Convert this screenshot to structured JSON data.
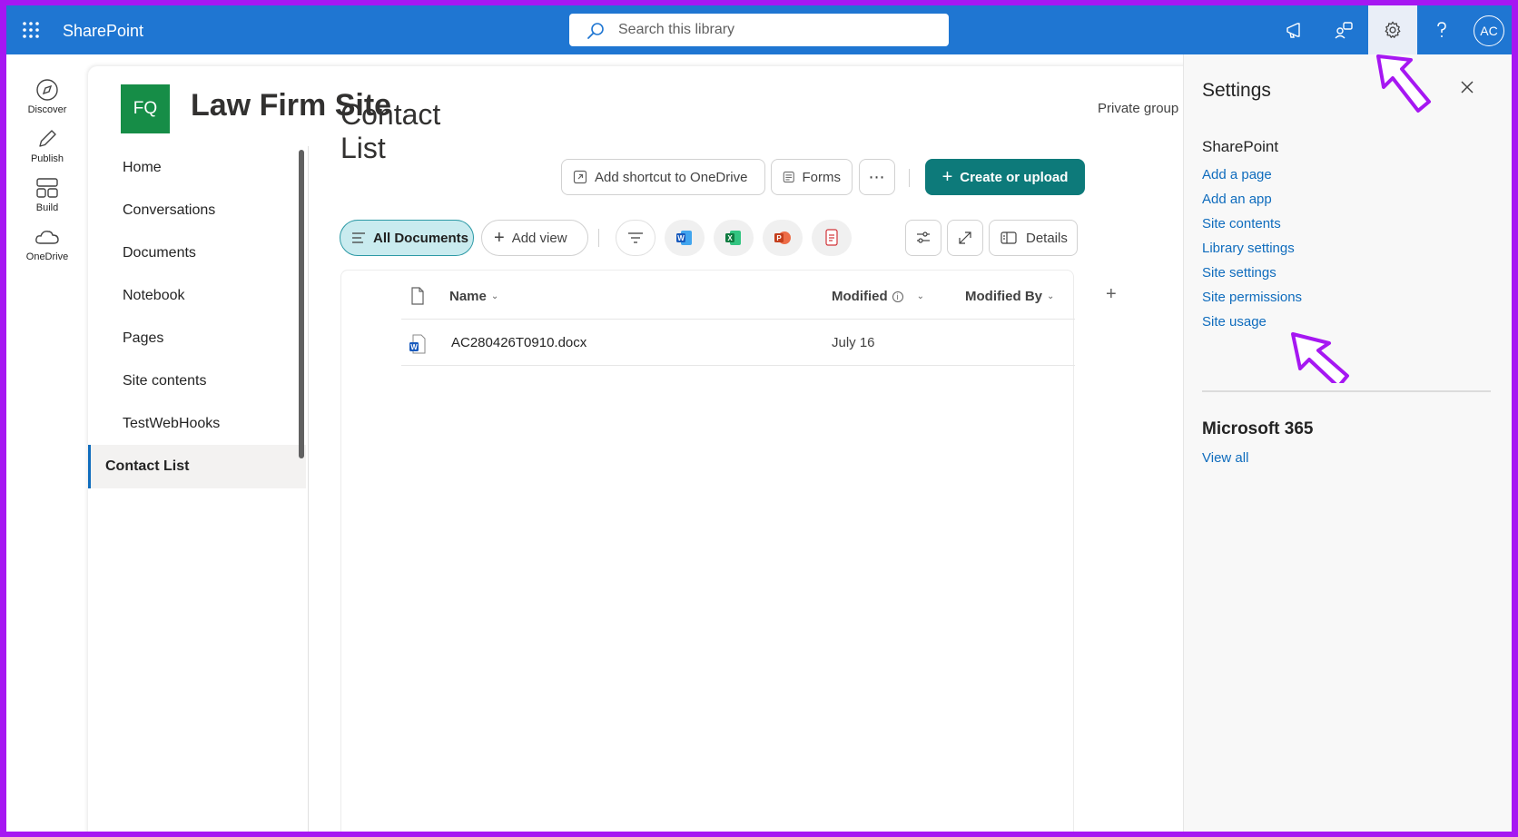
{
  "topbar": {
    "app_name": "SharePoint",
    "search_placeholder": "Search this library",
    "avatar_initials": "AC"
  },
  "appbar": {
    "items": [
      {
        "label": "Discover",
        "icon": "compass-icon"
      },
      {
        "label": "Publish",
        "icon": "pen-icon"
      },
      {
        "label": "Build",
        "icon": "layout-icon"
      },
      {
        "label": "OneDrive",
        "icon": "cloud-icon"
      }
    ]
  },
  "site": {
    "logo_initials": "FQ",
    "title": "Law Firm Site",
    "group_label": "Private group",
    "brand_color": "#168d47"
  },
  "nav": {
    "items": [
      {
        "label": "Home"
      },
      {
        "label": "Conversations"
      },
      {
        "label": "Documents"
      },
      {
        "label": "Notebook"
      },
      {
        "label": "Pages"
      },
      {
        "label": "Site contents"
      },
      {
        "label": "TestWebHooks"
      },
      {
        "label": "Contact List",
        "active": true
      }
    ]
  },
  "main": {
    "title": "Contact List",
    "toolbar": {
      "add_shortcut": "Add shortcut to OneDrive",
      "forms": "Forms",
      "create": "Create or upload"
    },
    "views": {
      "all_documents": "All Documents",
      "add_view": "Add view",
      "details": "Details"
    },
    "columns": {
      "name": "Name",
      "modified": "Modified",
      "modified_by": "Modified By"
    },
    "files": [
      {
        "name": "AC280426T0910.docx",
        "modified": "July 16",
        "modified_by": "",
        "type": "word"
      }
    ],
    "accent_color": "#0d7a7a"
  },
  "settings": {
    "title": "Settings",
    "sharepoint_heading": "SharePoint",
    "links": [
      "Add a page",
      "Add an app",
      "Site contents",
      "Library settings",
      "Site settings",
      "Site permissions",
      "Site usage"
    ],
    "ms365_heading": "Microsoft 365",
    "view_all": "View all",
    "link_color": "#0f6cbd"
  },
  "annotation": {
    "arrow_color": "#a617f2"
  }
}
